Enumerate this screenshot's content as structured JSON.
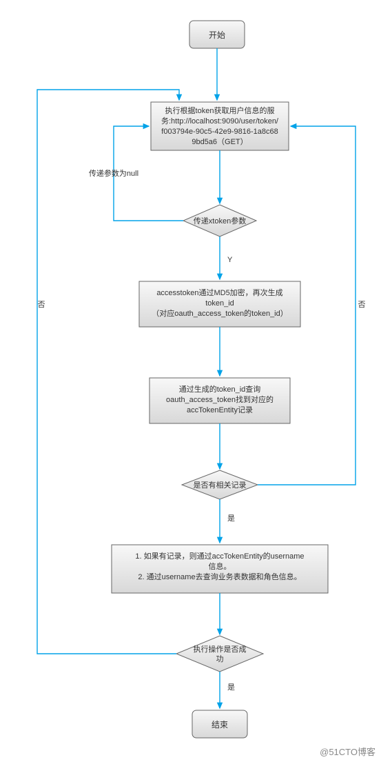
{
  "diagram": {
    "start": "开始",
    "step1_l1": "执行根据token获取用户信息的服",
    "step1_l2": "务:http://localhost:9090/user/token/",
    "step1_l3": "f003794e-90c5-42e9-9816-1a8c68",
    "step1_l4": "9bd5a6（GET）",
    "null_param": "传递参数为null",
    "decision1": "传递xtoken参数",
    "yes1": "Y",
    "no_left": "否",
    "no_right": "否",
    "step2_l1": "accesstoken通过MD5加密，再次生成",
    "step2_l2": "token_id",
    "step2_l3": "（对应oauth_access_token的token_id）",
    "step3_l1": "通过生成的token_id查询",
    "step3_l2": "oauth_access_token找到对应的",
    "step3_l3": "accTokenEntity记录",
    "decision2": "是否有相关记录",
    "yes2": "是",
    "step4_l1": "1. 如果有记录，则通过accTokenEntity的username",
    "step4_l2": "信息。",
    "step4_l3": "2. 通过username去查询业务表数据和角色信息。",
    "decision3_l1": "执行操作是否成",
    "decision3_l2": "功",
    "yes3": "是",
    "end": "结束",
    "watermark": "@51CTO博客"
  }
}
